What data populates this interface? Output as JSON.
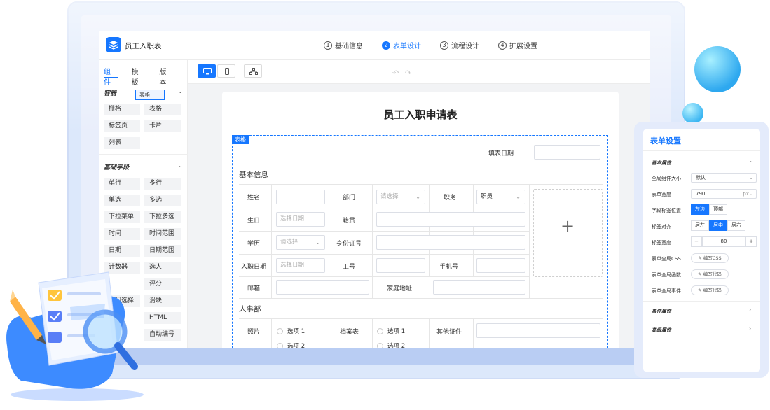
{
  "app": {
    "title": "员工入职表",
    "steps": [
      {
        "num": "1",
        "label": "基础信息"
      },
      {
        "num": "2",
        "label": "表单设计"
      },
      {
        "num": "3",
        "label": "流程设计"
      },
      {
        "num": "4",
        "label": "扩展设置"
      }
    ],
    "active_step": "表单设计"
  },
  "left_panel": {
    "tabs": [
      "组件",
      "模板",
      "版本"
    ],
    "active_tab": "组件",
    "container_section": "容器",
    "drag_chip": "表格",
    "container_items": [
      "栅格",
      "表格",
      "标签页",
      "卡片",
      "列表"
    ],
    "basic_section": "基础字段",
    "basic_items": [
      "单行",
      "多行",
      "单选",
      "多选",
      "下拉菜单",
      "下拉多选",
      "时间",
      "时间范围",
      "日期",
      "日期范围",
      "计数器",
      "选人",
      "评分",
      "部门选择",
      "滑块",
      "HTML",
      "自动编号"
    ],
    "partial_items": {
      "rate_left": "ⅰ",
      "dept_visible": "部门选择"
    }
  },
  "toolbar": {
    "devices": [
      "desktop",
      "mobile",
      "tree"
    ],
    "active_device": "desktop"
  },
  "form": {
    "title": "员工入职申请表",
    "selected_tag": "表格",
    "fill_date_label": "填表日期",
    "section_basic": "基本信息",
    "section_hr": "人事部",
    "fields": {
      "name": "姓名",
      "dept": "部门",
      "dept_placeholder": "请选择",
      "position": "职务",
      "position_value": "职员",
      "birthday": "生日",
      "birthday_placeholder": "选择日期",
      "native": "籍贯",
      "education": "学历",
      "education_placeholder": "请选择",
      "id_card": "身份证号",
      "entry_date": "入职日期",
      "entry_placeholder": "选择日期",
      "emp_no": "工号",
      "phone": "手机号",
      "email": "邮箱",
      "address": "家庭地址",
      "photo": "照片",
      "archive": "档案表",
      "other_cert": "其他证件",
      "option1": "选项 1",
      "option2": "选项 2"
    },
    "upload_icon": "plus-icon"
  },
  "settings": {
    "title": "表单设置",
    "basic_props": "基本属性",
    "global_size_label": "全局组件大小",
    "global_size_value": "默认",
    "width_label": "表单宽度",
    "width_value": "790",
    "width_unit": "px",
    "label_pos_label": "字段标签位置",
    "label_pos_options": [
      "左边",
      "顶部"
    ],
    "label_pos_active": "左边",
    "align_label": "标签对齐",
    "align_options": [
      "居左",
      "居中",
      "居右"
    ],
    "align_active": "居中",
    "label_width_label": "标签宽度",
    "label_width_value": "80",
    "minus": "−",
    "plus": "+",
    "css_label": "表单全局CSS",
    "css_btn": "编写CSS",
    "func_label": "表单全局函数",
    "func_btn": "编写代码",
    "event_label": "表单全局事件",
    "event_btn": "编写代码",
    "event_props": "事件属性",
    "advanced_props": "高级属性"
  },
  "colors": {
    "accent": "#1677ff",
    "frame": "#dce8fb"
  }
}
